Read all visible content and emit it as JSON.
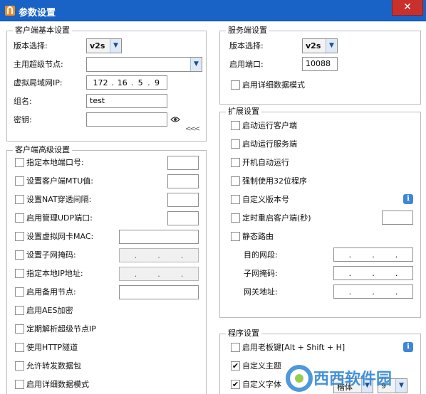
{
  "window": {
    "title": "参数设置",
    "close": "✕"
  },
  "client_basic": {
    "legend": "客户端基本设置",
    "version_label": "版本选择:",
    "version_value": "v2s",
    "supernode_label": "主用超级节点:",
    "supernode_value": "",
    "vlan_ip_label": "虚拟局域网IP:",
    "vlan_ip": [
      "172",
      "16",
      "5",
      "9"
    ],
    "group_label": "组名:",
    "group_value": "test",
    "key_label": "密钥:",
    "key_value": "",
    "collapse": "<<<"
  },
  "client_adv": {
    "legend": "客户端高级设置",
    "items": [
      {
        "label": "指定本地端口号:",
        "checked": false
      },
      {
        "label": "设置客户端MTU值:",
        "checked": false
      },
      {
        "label": "设置NAT穿透间隔:",
        "checked": false
      },
      {
        "label": "启用管理UDP端口:",
        "checked": false
      },
      {
        "label": "设置虚拟网卡MAC:",
        "checked": false
      },
      {
        "label": "设置子网掩码:",
        "checked": false
      },
      {
        "label": "指定本地IP地址:",
        "checked": false
      },
      {
        "label": "启用备用节点:",
        "checked": false
      },
      {
        "label": "启用AES加密",
        "checked": false
      },
      {
        "label": "定期解析超级节点IP",
        "checked": false
      },
      {
        "label": "使用HTTP隧道",
        "checked": false
      },
      {
        "label": "允许转发数据包",
        "checked": false
      },
      {
        "label": "启用详细数据模式",
        "checked": false
      }
    ],
    "ip_dots": [
      ".",
      ".",
      "."
    ]
  },
  "server": {
    "legend": "服务端设置",
    "version_label": "版本选择:",
    "version_value": "v2s",
    "port_label": "启用端口:",
    "port_value": "10088",
    "verbose_label": "启用详细数据模式",
    "verbose_checked": false
  },
  "ext": {
    "legend": "扩展设置",
    "items": [
      {
        "label": "启动运行客户端",
        "checked": false
      },
      {
        "label": "启动运行服务端",
        "checked": false
      },
      {
        "label": "开机自动运行",
        "checked": false
      },
      {
        "label": "强制使用32位程序",
        "checked": false
      },
      {
        "label": "自定义版本号",
        "checked": false
      },
      {
        "label": "定时重启客户端(秒)",
        "checked": false
      },
      {
        "label": "静态路由",
        "checked": false
      }
    ],
    "route_dest_label": "目的网段:",
    "route_mask_label": "子网掩码:",
    "route_gw_label": "网关地址:",
    "info": "i"
  },
  "program": {
    "legend": "程序设置",
    "items": [
      {
        "label": "启用老板键[Alt + Shift + H]",
        "checked": false
      },
      {
        "label": "自定义主题",
        "checked": true
      },
      {
        "label": "自定义字体",
        "checked": true
      }
    ],
    "font_value": "楷体",
    "font_size_value": "9",
    "checkmark": "✔"
  },
  "watermark": {
    "text": "西西软件园"
  },
  "colors": {
    "titlebar": "#1a63c6",
    "close": "#c9302c",
    "info": "#3f86d6"
  }
}
